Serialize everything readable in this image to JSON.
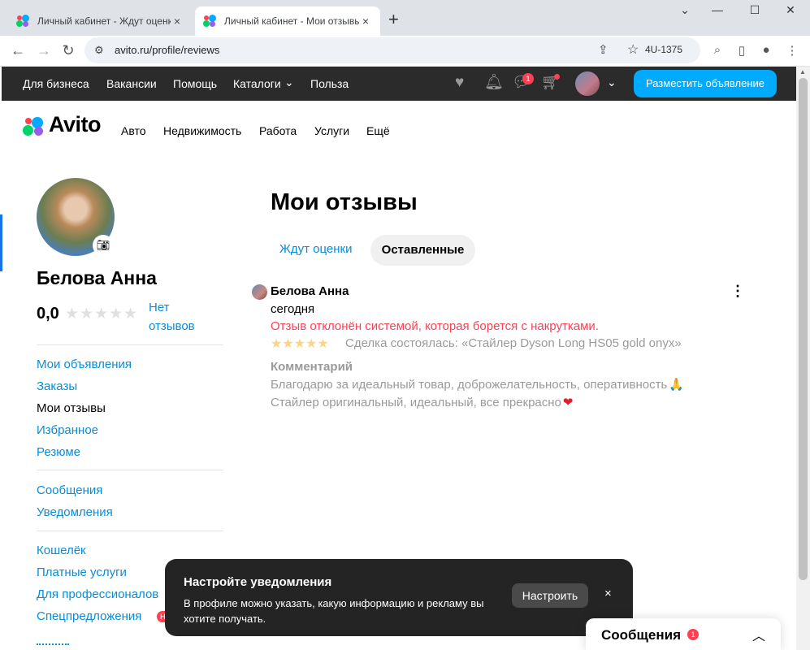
{
  "browser": {
    "tabs": [
      {
        "title": "Личный кабинет - Ждут оценки",
        "close": "×"
      },
      {
        "title": "Личный кабинет - Мои отзывы",
        "close": "×"
      }
    ],
    "new_tab": "+",
    "window": {
      "minimize": "⌄",
      "min2": "—",
      "max": "☐",
      "close": "✕"
    },
    "url": "avito.ru/profile/reviews",
    "extension_label": "4U-1375"
  },
  "topbar": {
    "links": [
      "Для бизнеса",
      "Вакансии",
      "Помощь",
      "Каталоги",
      "Польза"
    ],
    "catalog_chevron": "⌄",
    "messages_badge": "1",
    "post_button": "Разместить объявление"
  },
  "site_nav": {
    "logo": "Avito",
    "items": [
      "Авто",
      "Недвижимость",
      "Работа",
      "Услуги",
      "Ещё"
    ]
  },
  "sidebar": {
    "name": "Белова Анна",
    "rating": "0,0",
    "rating_stars": "★★★★★",
    "no_reviews": "Нет отзывов",
    "group1": [
      "Мои объявления",
      "Заказы",
      "Мои отзывы",
      "Избранное",
      "Резюме"
    ],
    "group2": [
      "Сообщения",
      "Уведомления"
    ],
    "group3": [
      "Кошелёк",
      "Платные услуги",
      "Для профессионалов",
      "Спецпредложения"
    ],
    "special_badge": "Н"
  },
  "main": {
    "title": "Мои отзывы",
    "tabs": [
      {
        "label": "Ждут оценки",
        "active": false
      },
      {
        "label": "Оставленные",
        "active": true
      }
    ],
    "review": {
      "author": "Белова Анна",
      "date": "сегодня",
      "status": "Отзыв отклонён системой, которая борется с накрутками.",
      "stars": "★★★★★",
      "deal": "Сделка состоялась: «Стайлер Dyson Long HS05 gold onyx»",
      "comment_heading": "Комментарий",
      "comment_line1": "Благодарю за идеальный товар, доброжелательность, оперативность",
      "comment_line1_emoji": "🙏",
      "comment_line2": "Стайлер оригинальный, идеальный, все прекрасно",
      "comment_line2_emoji": "❤"
    }
  },
  "toast": {
    "title": "Настройте уведомления",
    "body": "В профиле можно указать, какую информацию и рекламу вы хотите получать.",
    "button": "Настроить",
    "close": "×"
  },
  "messenger": {
    "title": "Сообщения",
    "badge": "1",
    "chevron": "︿"
  },
  "colors": {
    "accent_blue": "#00aaff",
    "link_blue": "#0a8cd6",
    "error_red": "#ff4053",
    "dark_bar": "#2b2b2b",
    "star_gold": "#ffb021"
  }
}
